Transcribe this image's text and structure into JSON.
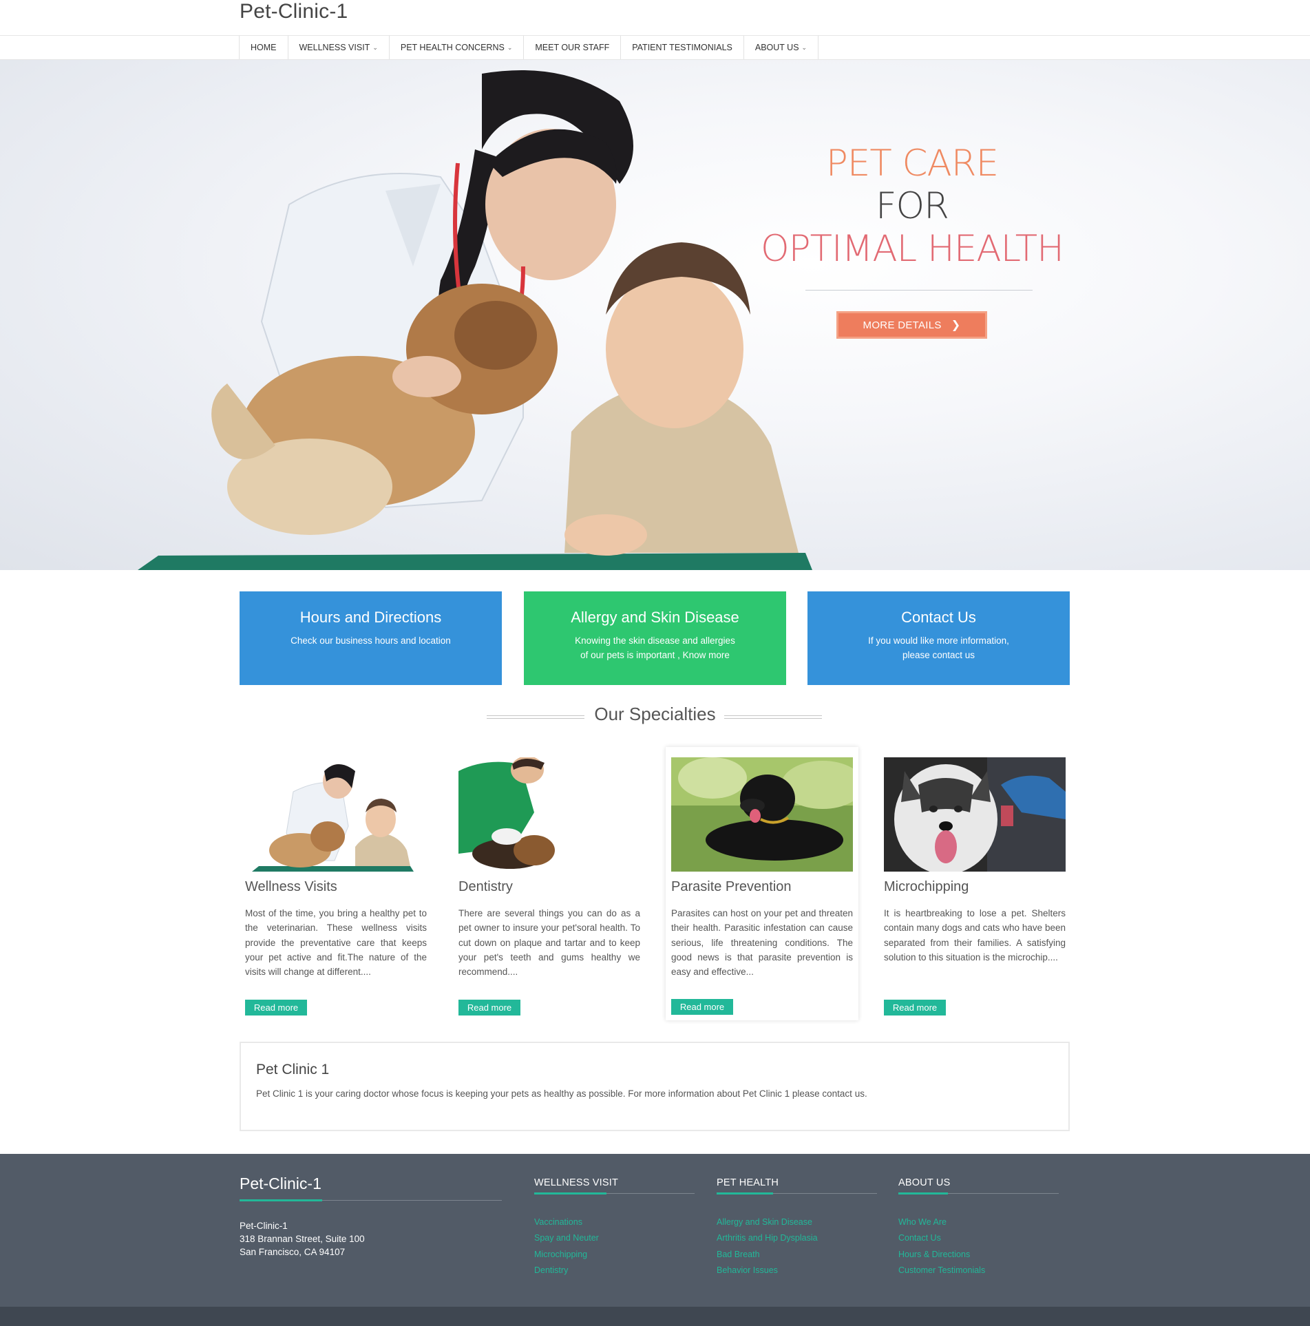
{
  "header": {
    "logo": "Pet-Clinic-1"
  },
  "nav": {
    "items": [
      {
        "label": "HOME",
        "dropdown": false
      },
      {
        "label": "WELLNESS VISIT",
        "dropdown": true
      },
      {
        "label": "PET HEALTH CONCERNS",
        "dropdown": true
      },
      {
        "label": "MEET OUR STAFF",
        "dropdown": false
      },
      {
        "label": "PATIENT TESTIMONIALS",
        "dropdown": false
      },
      {
        "label": "ABOUT US",
        "dropdown": true
      }
    ]
  },
  "hero": {
    "line1": "PET CARE",
    "line2": "FOR",
    "line3": "OPTIMAL HEALTH",
    "button": "MORE DETAILS",
    "colors": {
      "accent": "#ee7d5d",
      "line1": "#ef8a62",
      "line3": "#e26a73"
    }
  },
  "features": [
    {
      "title": "Hours and Directions",
      "text": "Check our business hours and location",
      "color": "#3592da"
    },
    {
      "title": "Allergy and Skin Disease",
      "text": "Knowing the skin disease  and allergies of our pets is important , Know more",
      "color": "#2ec770"
    },
    {
      "title": "Contact Us",
      "text": "If you would like more information, please contact us",
      "color": "#3592da"
    }
  ],
  "specialties": {
    "heading": "Our Specialties",
    "read_more": "Read more",
    "items": [
      {
        "title": "Wellness Visits",
        "text": "Most of the time, you bring a healthy pet to the veterinarian. These wellness visits provide the preventative care that keeps your pet active and fit.The nature of the visits will change at different...."
      },
      {
        "title": "Dentistry",
        "text": "There are several things you can do as a pet owner to insure your pet'soral health. To cut down on plaque and tartar and to keep your pet's teeth and gums healthy we recommend...."
      },
      {
        "title": "Parasite Prevention",
        "text": "Parasites can host on your pet and threaten their health. Parasitic infestation can cause serious, life threatening conditions. The good news is that parasite prevention is easy and effective..."
      },
      {
        "title": "Microchipping",
        "text": "It is heartbreaking to lose a pet. Shelters contain many dogs and cats who have been separated from their families. A satisfying solution to this situation is the microchip...."
      }
    ]
  },
  "about": {
    "title": "Pet Clinic 1",
    "text": "Pet Clinic 1 is your caring doctor whose focus is keeping your pets as healthy as possible. For more information about Pet Clinic 1 please contact us."
  },
  "footer": {
    "brand": "Pet-Clinic-1",
    "address": [
      "Pet-Clinic-1",
      "318 Brannan Street, Suite 100",
      "San Francisco, CA 94107"
    ],
    "columns": [
      {
        "title": "WELLNESS VISIT",
        "links": [
          "Vaccinations",
          "Spay and Neuter",
          "Microchipping",
          "Dentistry"
        ]
      },
      {
        "title": "PET HEALTH",
        "links": [
          "Allergy and Skin Disease",
          "Arthritis and Hip Dysplasia",
          "Bad Breath",
          "Behavior Issues"
        ]
      },
      {
        "title": "ABOUT US",
        "links": [
          "Who We Are",
          "Contact Us",
          "Hours & Directions",
          "Customer Testimonials"
        ]
      }
    ],
    "accent": "#22b899",
    "background": "#525b67"
  }
}
